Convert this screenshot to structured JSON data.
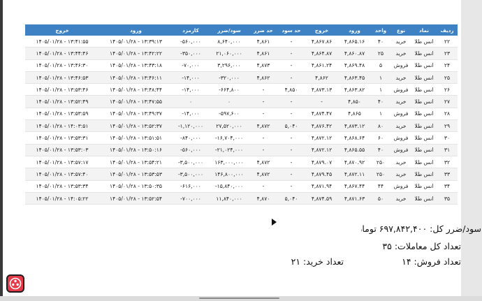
{
  "table": {
    "headers": [
      "ردیف",
      "نماد",
      "نوع",
      "واحد",
      "ورود",
      "خروج",
      "حد سود",
      "حد ضرر",
      "سود/ضرر",
      "کارمزد",
      "ورود",
      "خروج"
    ],
    "rows": [
      [
        "۲۲",
        "انس طلا",
        "خرید",
        "۴۰",
        "۴,۸۶۵.۱۶",
        "۴,۸۶۷.۸۶",
        "-",
        "۴,۸۶۱",
        "۸,۶۴۰,۰۰۰",
        "-۵۶۰,۰۰۰",
        "۱۴۰۵/۰۱/۲۸ - ۱۳:۳۹:۱۳",
        "۱۴۰۵/۰۱/۲۸ - ۱۳:۴۱:۵۵"
      ],
      [
        "۲۳",
        "انس طلا",
        "خرید",
        "۲۵",
        "۴,۸۶۰.۸۷",
        "۴,۸۶۴.۸۷",
        "-",
        "۴,۸۶۱",
        "۲۱,۰۶۰,۰۰۰",
        "-۳۵۰,۰۰۰",
        "۱۴۰۵/۰۱/۲۸ - ۱۳:۴۲:۲۲",
        "۱۴۰۵/۰۱/۲۸ - ۱۳:۴۴:۴۶"
      ],
      [
        "۲۴",
        "انس طلا",
        "فروش",
        "۵",
        "۴,۸۶۹.۴۸",
        "۴,۸۶۱.۲۴",
        "-",
        "۴,۸۷۳",
        "۳,۲۹۶,۰۰۰",
        "-۷۰,۰۰۰",
        "۱۴۰۵/۰۱/۲۸ - ۱۳:۴۳:۱۸",
        "۱۴۰۵/۰۱/۲۸ - ۱۳:۴۶:۳۰"
      ],
      [
        "۲۵",
        "انس طلا",
        "خرید",
        "۱",
        "۴,۸۶۳.۴۵",
        "۴,۸۶۲",
        "-",
        "۴,۸۶۲",
        "-۳۲۰,۰۰۰",
        "-۱۴,۰۰۰",
        "۱۴۰۵/۰۱/۲۸ - ۱۳:۴۶:۱۱",
        "۱۴۰۵/۰۱/۲۸ - ۱۳:۴۶:۵۳"
      ],
      [
        "۲۶",
        "انس طلا",
        "فروش",
        "۱",
        "۴,۸۶۳.۸۲",
        "۴,۸۷۳.۱۳",
        "۴,۸۵۰",
        "-",
        "-۶۶۴,۸۰۰",
        "-۱۴,۰۰۰",
        "۱۴۰۵/۰۱/۲۸ - ۱۳:۴۸:۴۴",
        "۱۴۰۵/۰۱/۲۸ - ۱۳:۵۳:۴۶"
      ],
      [
        "۲۷",
        "انس طلا",
        "خرید",
        "۴۰",
        "۴,۸۵۰",
        "-",
        "-",
        "-",
        "۰",
        "۰",
        "۱۴۰۵/۰۱/۲۸ - ۱۳:۴۷:۵۵",
        "۱۴۰۵/۰۱/۲۸ - ۱۳:۵۲:۴۹"
      ],
      [
        "۲۸",
        "انس طلا",
        "فروش",
        "۱",
        "۴,۸۶۵",
        "۴,۸۷۴.۴۷",
        "-",
        "-",
        "-۵۹۷,۶۰۰",
        "-۱۴,۰۰۰",
        "۱۴۰۵/۰۱/۲۸ - ۱۳:۴۹:۳۷",
        "۱۴۰۵/۰۱/۲۸ - ۱۳:۵۳:۵۹"
      ],
      [
        "۲۹",
        "انس طلا",
        "خرید",
        "۸۰",
        "۴,۸۷۳.۱۲",
        "۴,۸۷۶.۴۲",
        "۵,۰۴۰",
        "۴,۸۷۲",
        "۲۷,۵۲۰,۰۰۰",
        "-۱,۱۲۰,۰۰۰",
        "۱۴۰۵/۰۱/۲۸ - ۱۳:۵۲:۳۷",
        "۱۴۰۵/۰۱/۲۸ - ۱۴:۰۳:۵۱"
      ],
      [
        "۳۰",
        "انس طلا",
        "فروش",
        "۶۰",
        "۴,۸۶۸.۶۴",
        "۴,۸۷۲.۱۲",
        "-",
        "-",
        "-۱۶,۷۰۴,۰۰۰",
        "-۸۴۰,۰۰۰",
        "۱۴۰۵/۰۱/۲۸ - ۱۳:۵۱:۵۱",
        "۱۴۰۵/۰۱/۲۸ - ۱۳:۵۳:۳۱"
      ],
      [
        "۳۱",
        "انس طلا",
        "فروش",
        "۴۰",
        "۴,۸۶۵.۵۵",
        "۴,۸۷۲.۱۲",
        "-",
        "-",
        "-۲۱,۰۲۴,۰۰۰",
        "-۵۶۰,۰۰۰",
        "۱۴۰۵/۰۱/۲۸ - ۱۳:۵۰:۱۶",
        "۱۴۰۵/۰۱/۲۸ - ۱۳:۵۳:۰۳"
      ],
      [
        "۳۲",
        "انس طلا",
        "خرید",
        "۲۵۰",
        "۴,۸۷۰.۹۲",
        "۴,۸۷۹.۰۷",
        "-",
        "۴,۸۷۲",
        "۱۶۳,۰۰۰,۰۰۰",
        "-۳,۵۰۰,۰۰۰",
        "۱۴۰۵/۰۱/۲۸ - ۱۳:۵۴:۲۱",
        "۱۴۰۵/۰۱/۲۸ - ۱۳:۵۷:۱۷"
      ],
      [
        "۳۳",
        "انس طلا",
        "خرید",
        "۲۵۰",
        "۴,۸۷۲.۱۱",
        "۴,۸۷۹.۴۵",
        "-",
        "۴,۸۷۲",
        "۱۴۶,۸۰۰,۰۰۰",
        "-۳,۵۰۰,۰۰۰",
        "۱۴۰۵/۰۱/۲۸ - ۱۳:۵۳:۵۳",
        "۱۴۰۵/۰۱/۲۸ - ۱۳:۵۷:۴۰"
      ],
      [
        "۳۴",
        "انس طلا",
        "فروش",
        "۴۴",
        "۴,۸۶۷.۴۴",
        "۴,۸۷۱.۹۴",
        "-",
        "-",
        "-۱۵,۸۴۰,۰۰۰",
        "-۶۱۶,۰۰۰",
        "۱۴۰۵/۰۱/۲۸ - ۱۳:۵۰:۳۵",
        "۱۴۰۵/۰۱/۲۸ - ۱۳:۵۳:۳۴"
      ],
      [
        "۳۵",
        "انس طلا",
        "خرید",
        "۵۰",
        "۴,۸۷۱.۶۳",
        "۴,۸۷۴.۵۹",
        "۵,۰۴۰",
        "۴,۸۷۰",
        "۱۱,۸۴۰,۰۰۰",
        "-۷۰۰,۰۰۰",
        "۱۴۰۵/۰۱/۲۸ - ۱۳:۵۲:۵۴",
        "۱۴۰۵/۰۱/۲۸ - ۱۴:۰۵:۲۲"
      ]
    ]
  },
  "summary": {
    "profit_label": "سود/ضرر کل:",
    "profit_value": "۶۹۷,۸۴۲,۴۰۰ تومان",
    "total_label": "تعداد کل معاملات:",
    "total_value": "۳۵",
    "sell_label": "تعداد فروش:",
    "sell_value": "۱۴",
    "buy_label": "تعداد خرید:",
    "buy_value": "۲۱"
  },
  "icons": {
    "logo": "app-logo-icon",
    "cursor": "mouse-pointer-icon"
  },
  "colors": {
    "header_bg": "#3e82c4",
    "logo_bg": "#e53a49"
  }
}
